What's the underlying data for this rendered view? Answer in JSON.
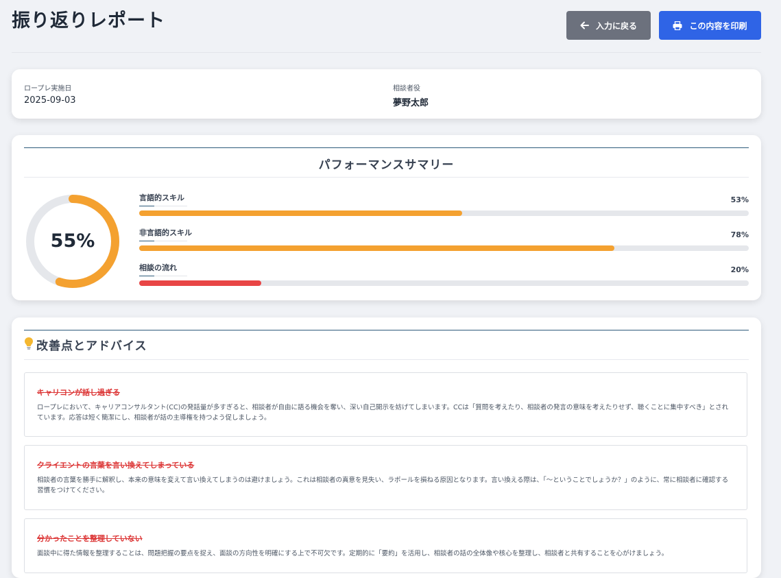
{
  "header": {
    "title": "振り返りレポート",
    "back_label": "入力に戻る",
    "print_label": "この内容を印刷"
  },
  "info": {
    "date_label": "ロープレ実施日",
    "date_value": "2025-09-03",
    "counselee_label": "相談者役",
    "counselee_value": "夢野太郎"
  },
  "summary": {
    "title": "パフォーマンスサマリー",
    "overall_value": 55,
    "overall": "55%",
    "skills": [
      {
        "label": "言語的スキル",
        "value": 53,
        "percent": "53%",
        "color": "#f4a130"
      },
      {
        "label": "非言語的スキル",
        "value": 78,
        "percent": "78%",
        "color": "#f4a130"
      },
      {
        "label": "相談の流れ",
        "value": 20,
        "percent": "20%",
        "color": "#e84545"
      }
    ],
    "gauge_color": "#f4a130",
    "track_color": "#e5e7eb"
  },
  "advice": {
    "title": "改善点とアドバイス",
    "icon": "lightbulb-icon",
    "items": [
      {
        "title": "キャリコンが話し過ぎる",
        "body": "ロープレにおいて、キャリアコンサルタント(CC)の発話量が多すぎると、相談者が自由に語る機会を奪い、深い自己開示を妨げてしまいます。CCは「質問を考えたり、相談者の発言の意味を考えたりせず、聴くことに集中すべき」とされています。応答は短く簡潔にし、相談者が話の主導権を持つよう促しましょう。"
      },
      {
        "title": "クライエントの言葉を言い換えてしまっている",
        "body": "相談者の言葉を勝手に解釈し、本来の意味を変えて言い換えてしまうのは避けましょう。これは相談者の真意を見失い、ラポールを損ねる原因となります。言い換える際は、「〜ということでしょうか？」のように、常に相談者に確認する習慣をつけてください。"
      },
      {
        "title": "分かったことを整理していない",
        "body": "面談中に得た情報を整理することは、問題把握の要点を捉え、面談の方向性を明確にする上で不可欠です。定期的に「要約」を活用し、相談者の話の全体像や核心を整理し、相談者と共有することを心がけましょう。"
      }
    ]
  }
}
